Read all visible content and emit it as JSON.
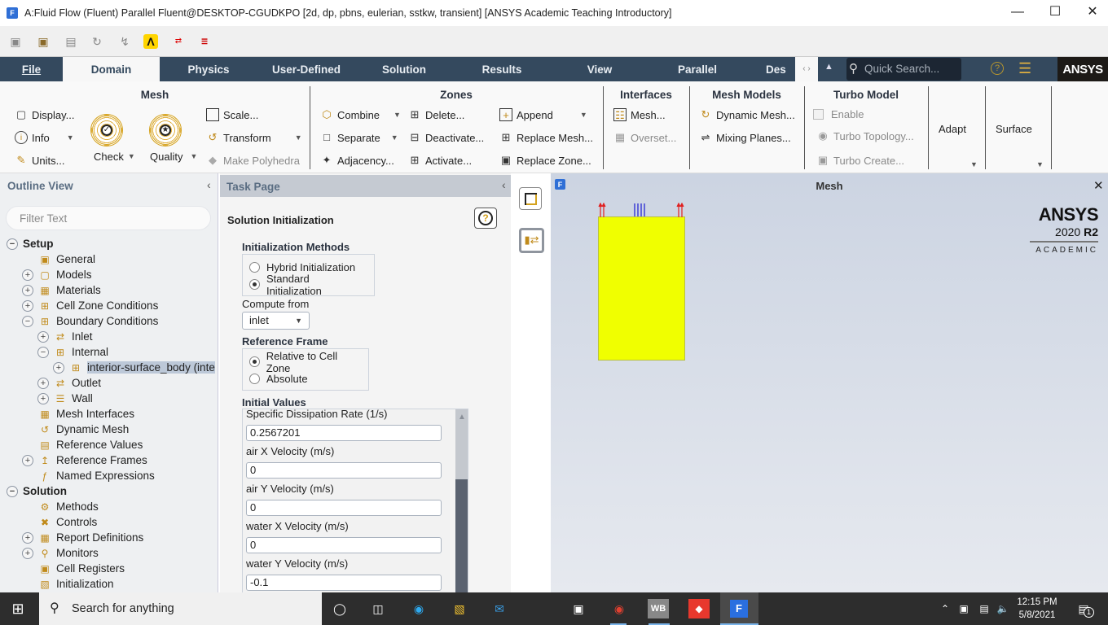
{
  "window": {
    "title": "A:Fluid Flow (Fluent) Parallel Fluent@DESKTOP-CGUDKPO  [2d, dp, pbns, eulerian, sstkw, transient] [ANSYS Academic Teaching Introductory]",
    "app_icon": "F"
  },
  "ribbon_tabs": [
    "File",
    "Domain",
    "Physics",
    "User-Defined",
    "Solution",
    "Results",
    "View",
    "Parallel",
    "Des"
  ],
  "quick_search_placeholder": "Quick Search...",
  "brand": "ANSYS",
  "ribbon": {
    "mesh": {
      "title": "Mesh",
      "display": "Display...",
      "info": "Info",
      "units": "Units...",
      "check": "Check",
      "quality": "Quality",
      "scale": "Scale...",
      "transform": "Transform",
      "make_polyhedra": "Make Polyhedra"
    },
    "zones": {
      "title": "Zones",
      "combine": "Combine",
      "separate": "Separate",
      "adjacency": "Adjacency...",
      "delete": "Delete...",
      "deactivate": "Deactivate...",
      "activate": "Activate...",
      "append": "Append",
      "replace_mesh": "Replace Mesh...",
      "replace_zone": "Replace Zone..."
    },
    "interfaces": {
      "title": "Interfaces",
      "mesh": "Mesh...",
      "overset": "Overset..."
    },
    "mesh_models": {
      "title": "Mesh Models",
      "dynamic_mesh": "Dynamic Mesh...",
      "mixing_planes": "Mixing Planes..."
    },
    "turbo": {
      "title": "Turbo Model",
      "enable": "Enable",
      "topology": "Turbo Topology...",
      "create": "Turbo Create..."
    },
    "adapt": "Adapt",
    "surface": "Surface"
  },
  "outline": {
    "title": "Outline View",
    "filter_placeholder": "Filter Text",
    "items": [
      {
        "label": "Setup",
        "level": 0,
        "exp": "-",
        "bold": true
      },
      {
        "label": "General",
        "level": 1,
        "exp": ""
      },
      {
        "label": "Models",
        "level": 1,
        "exp": "+"
      },
      {
        "label": "Materials",
        "level": 1,
        "exp": "+"
      },
      {
        "label": "Cell Zone Conditions",
        "level": 1,
        "exp": "+"
      },
      {
        "label": "Boundary Conditions",
        "level": 1,
        "exp": "-"
      },
      {
        "label": "Inlet",
        "level": 2,
        "exp": "+"
      },
      {
        "label": "Internal",
        "level": 2,
        "exp": "-"
      },
      {
        "label": "interior-surface_body (inte",
        "level": 3,
        "exp": "+",
        "selected": true
      },
      {
        "label": "Outlet",
        "level": 2,
        "exp": "+"
      },
      {
        "label": "Wall",
        "level": 2,
        "exp": "+"
      },
      {
        "label": "Mesh Interfaces",
        "level": 1,
        "exp": ""
      },
      {
        "label": "Dynamic Mesh",
        "level": 1,
        "exp": ""
      },
      {
        "label": "Reference Values",
        "level": 1,
        "exp": ""
      },
      {
        "label": "Reference Frames",
        "level": 1,
        "exp": "+"
      },
      {
        "label": "Named Expressions",
        "level": 1,
        "exp": ""
      },
      {
        "label": "Solution",
        "level": 0,
        "exp": "-",
        "bold": true
      },
      {
        "label": "Methods",
        "level": 1,
        "exp": ""
      },
      {
        "label": "Controls",
        "level": 1,
        "exp": ""
      },
      {
        "label": "Report Definitions",
        "level": 1,
        "exp": "+"
      },
      {
        "label": "Monitors",
        "level": 1,
        "exp": "+"
      },
      {
        "label": "Cell Registers",
        "level": 1,
        "exp": ""
      },
      {
        "label": "Initialization",
        "level": 1,
        "exp": ""
      }
    ]
  },
  "task": {
    "header": "Task Page",
    "title": "Solution Initialization",
    "init_methods": "Initialization Methods",
    "hybrid": "Hybrid  Initialization",
    "standard": "Standard Initialization",
    "compute_from": "Compute from",
    "compute_value": "inlet",
    "ref_frame": "Reference Frame",
    "relative": "Relative to Cell Zone",
    "absolute": "Absolute",
    "initial_values": "Initial Values",
    "fields": [
      {
        "label": "Specific Dissipation Rate (1/s)",
        "value": "0.2567201"
      },
      {
        "label": "air X Velocity (m/s)",
        "value": "0"
      },
      {
        "label": "air Y Velocity (m/s)",
        "value": "0"
      },
      {
        "label": "water X Velocity (m/s)",
        "value": "0"
      },
      {
        "label": "water Y Velocity (m/s)",
        "value": "-0.1"
      }
    ]
  },
  "graphics": {
    "title": "Mesh",
    "logo_brand": "ANSYS",
    "logo_version": "2020",
    "logo_release": "R2",
    "logo_edition": "ACADEMIC",
    "mesh_color": "#f0ff00"
  },
  "taskbar": {
    "search": "Search for anything",
    "time": "12:15 PM",
    "date": "5/8/2021",
    "notifications": "1"
  }
}
